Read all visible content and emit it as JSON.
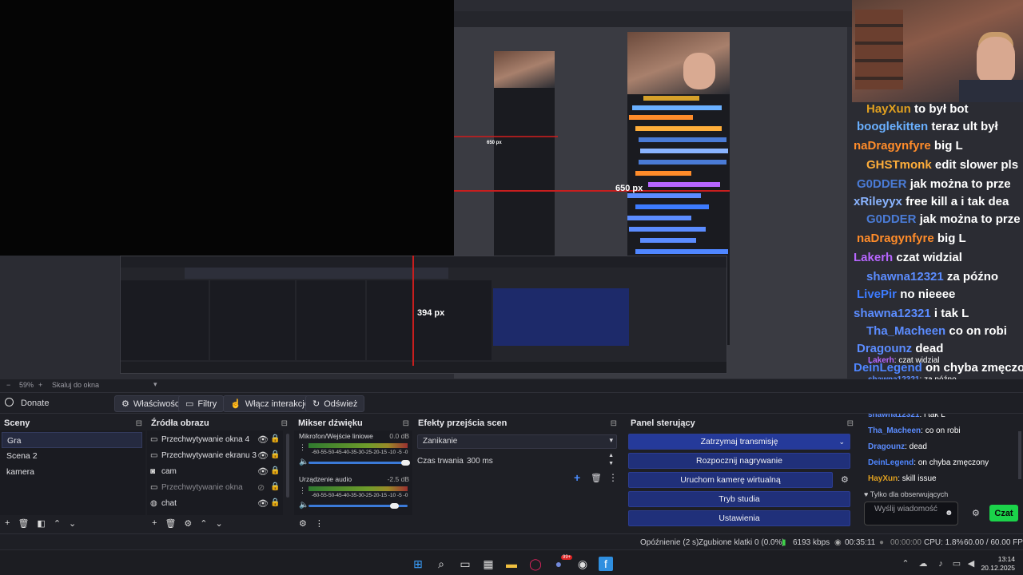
{
  "preview": {
    "zoom": "59%",
    "zoom_plus": "+",
    "scale_label": "Skaluj do okna",
    "guide_h_label": "650 px",
    "guide_v_label": "394 px",
    "inner_guide_label": "650 px"
  },
  "toolbar": {
    "scene_name": "Donate",
    "properties_label": "Właściwości",
    "filters_label": "Filtry",
    "interact_label": "Włącz interakcję",
    "refresh_label": "Odśwież"
  },
  "scenes": {
    "title": "Sceny",
    "items": [
      "Gra",
      "Scena 2",
      "kamera"
    ]
  },
  "sources": {
    "title": "Źródła obrazu",
    "items": [
      {
        "label": "Przechwytywanie okna 4",
        "icon": "window-icon",
        "visible": true
      },
      {
        "label": "Przechwytywanie ekranu 3",
        "icon": "monitor-icon",
        "visible": true
      },
      {
        "label": "cam",
        "icon": "camera-icon",
        "visible": true
      },
      {
        "label": "Przechwytywanie okna",
        "icon": "window-icon",
        "visible": false
      },
      {
        "label": "chat",
        "icon": "globe-icon",
        "visible": true
      }
    ]
  },
  "mixer": {
    "title": "Mikser dźwięku",
    "channels": [
      {
        "name": "Mikrofon/Wejście liniowe",
        "db": "0.0 dB",
        "scale": "-60-55-50-45-40-35-30-25-20-15 -10 -5 -0",
        "level": 0.95
      },
      {
        "name": "Urządzenie audio",
        "db": "-2.5 dB",
        "scale": "-60-55-50-45-40-35-30-25-20-15 -10 -5 -0",
        "level": 0.8
      }
    ]
  },
  "transitions": {
    "title": "Efekty przejścia scen",
    "selected": "Zanikanie",
    "duration_label": "Czas trwania",
    "duration_value": "300 ms"
  },
  "controls": {
    "title": "Panel sterujący",
    "buttons": [
      "Zatrzymaj transmisję",
      "Rozpocznij nagrywanie",
      "Uruchom kamerę wirtualną",
      "Tryb studia",
      "Ustawienia"
    ]
  },
  "status": {
    "delay": "Opóźnienie (2 s)",
    "dropped": "Zgubione klatki 0 (0.0%)",
    "bitrate": "6193 kbps",
    "stream_time": "00:35:11",
    "rec_time": "00:00:00",
    "cpu": "CPU: 1.8%",
    "fps": "60.00 / 60.00 FPS"
  },
  "taskbar": {
    "time": "13:14",
    "date": "20.12.2025",
    "badge": "99+"
  },
  "chat": {
    "followers_only": "Tylko dla obserwujących",
    "input_placeholder": "Wyślij wiadomość",
    "send_label": "Czat",
    "overlay_lines": [
      {
        "name": "HayXun",
        "text": "to był bot",
        "color": "#e0a020",
        "big": true
      },
      {
        "name": "booglekitten",
        "text": "teraz ult był",
        "color": "#6ab0ff",
        "big": true
      },
      {
        "name": "naDragynfyre",
        "text": "big L",
        "color": "#ff8c2a",
        "big": true
      },
      {
        "name": "GHSTmonk",
        "text": "edit slower pls",
        "color": "#ffae3a",
        "big": true
      },
      {
        "name": "G0DDER",
        "text": "jak można to prze",
        "color": "#4a7bd6",
        "big": true
      },
      {
        "name": "xRileyyx",
        "text": "free kill a i tak dea",
        "color": "#8ab4ff",
        "big": true
      },
      {
        "name": "G0DDER",
        "text": "jak można to prze",
        "color": "#4a7bd6",
        "big": true
      },
      {
        "name": "naDragynfyre",
        "text": "big L",
        "color": "#ff8c2a",
        "big": true
      },
      {
        "name": "Lakerh",
        "text": "czat widzial",
        "color": "#b766ff",
        "big": true
      },
      {
        "name": "shawna12321",
        "text": "za późno",
        "color": "#5b8cff",
        "big": true
      },
      {
        "name": "LivePir",
        "text": "no nieeee",
        "color": "#3d7bff",
        "big": true
      },
      {
        "name": "shawna12321",
        "text": "i tak L",
        "color": "#5b8cff",
        "big": true
      },
      {
        "name": "Tha_Macheen",
        "text": "co on robi",
        "color": "#5b8cff",
        "big": true
      },
      {
        "name": "Dragounz",
        "text": "dead",
        "color": "#5b8cff",
        "big": true
      },
      {
        "name": "DeinLegend",
        "text": "on chyba zmęczony",
        "color": "#4f86ff",
        "big": true
      },
      {
        "name": "HayXun",
        "text": "skill issue",
        "color": "#e0a020",
        "big": true
      }
    ],
    "list_lines": [
      {
        "name": "Lakerh",
        "text": "czat widzial",
        "color": "#b766ff"
      },
      {
        "name": "shawna12321",
        "text": "za późno",
        "color": "#5b8cff"
      },
      {
        "name": "LivePirru",
        "text": "no nieeee",
        "color": "#3d7bff"
      },
      {
        "name": "shawna12321",
        "text": "i tak L",
        "color": "#5b8cff"
      },
      {
        "name": "Tha_Macheen",
        "text": "co on robi",
        "color": "#5b8cff"
      },
      {
        "name": "Dragounz",
        "text": "dead",
        "color": "#5b8cff"
      },
      {
        "name": "DeinLegend",
        "text": "on chyba zmęczony",
        "color": "#4f86ff"
      },
      {
        "name": "HayXun",
        "text": "skill issue",
        "color": "#e0a020"
      }
    ]
  }
}
